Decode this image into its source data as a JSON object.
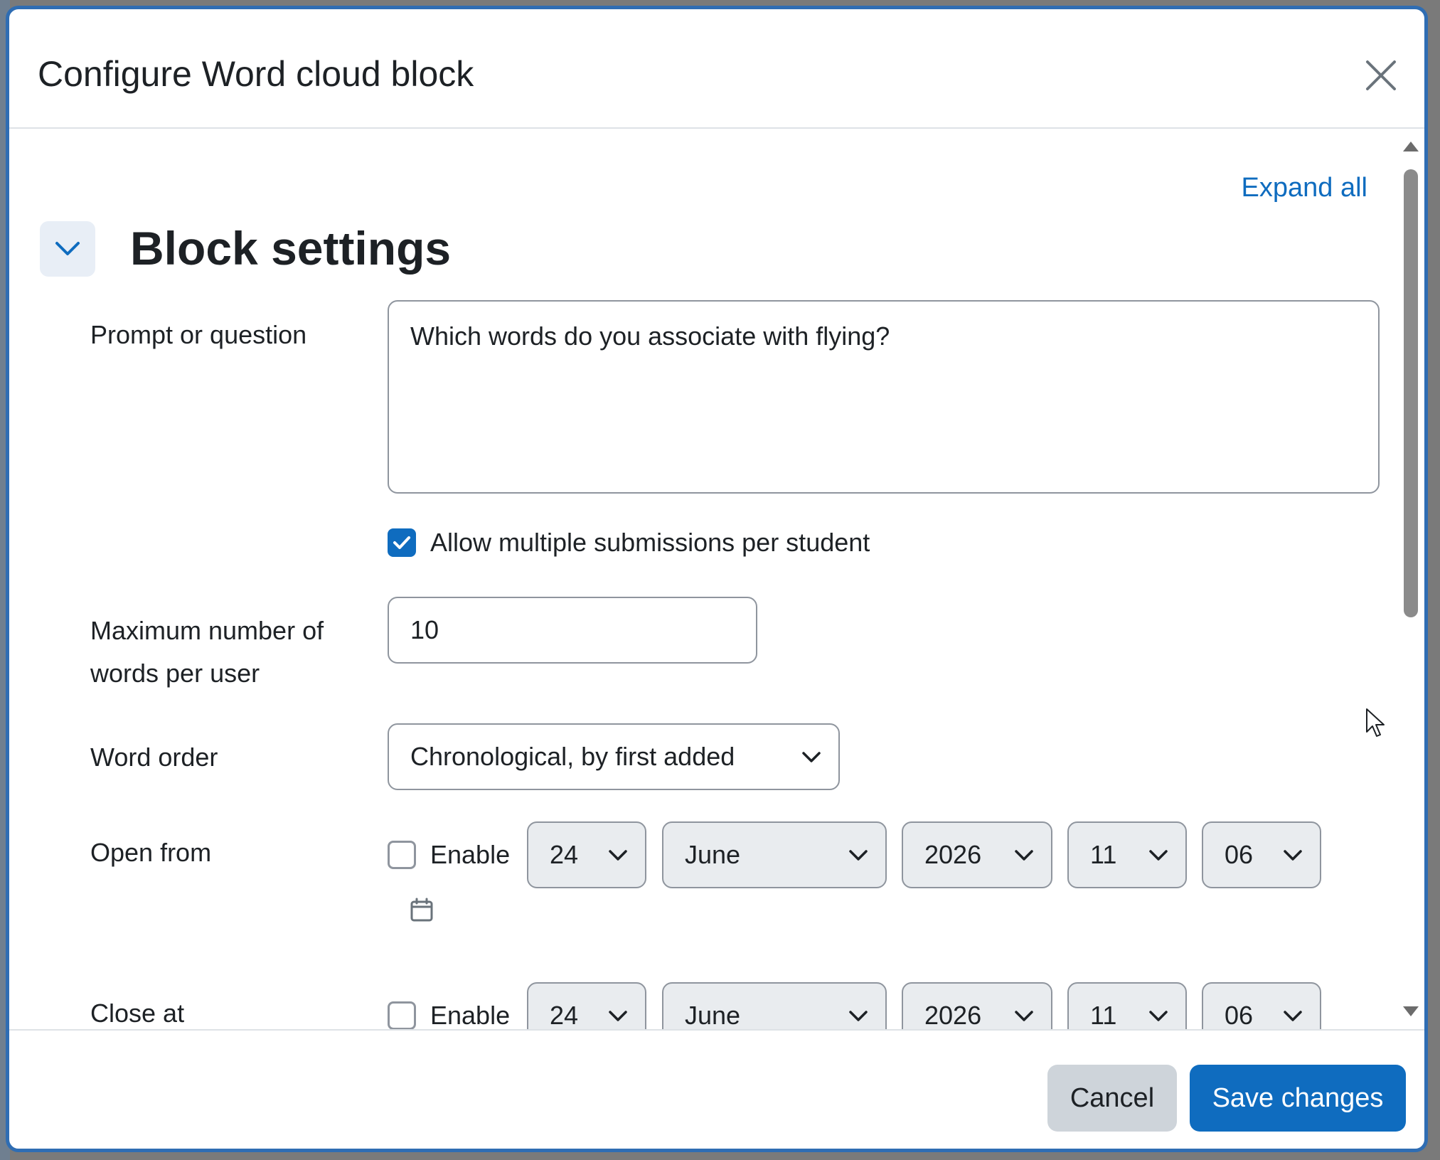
{
  "modal": {
    "title": "Configure Word cloud block",
    "expand_all": "Expand all",
    "section_title": "Block settings"
  },
  "form": {
    "prompt_label": "Prompt or question",
    "prompt_value": "Which words do you associate with flying?",
    "allow_multiple_label": "Allow multiple submissions per student",
    "allow_multiple_checked": true,
    "max_words_label_line1": "Maximum number of",
    "max_words_label_line2": "words per user",
    "max_words_value": "10",
    "word_order_label": "Word order",
    "word_order_value": "Chronological, by first added",
    "open_from": {
      "label": "Open from",
      "enable_label": "Enable",
      "enabled": false,
      "day": "24",
      "month": "June",
      "year": "2026",
      "hour": "11",
      "minute": "06"
    },
    "close_at": {
      "label": "Close at",
      "enable_label": "Enable",
      "enabled": false,
      "day": "24",
      "month": "June",
      "year": "2026",
      "hour": "11",
      "minute": "06"
    }
  },
  "footer": {
    "cancel_label": "Cancel",
    "save_label": "Save changes"
  },
  "colors": {
    "primary": "#0f6cbf",
    "modal_border": "#2f6db3",
    "secondary_button": "#ced4da"
  }
}
